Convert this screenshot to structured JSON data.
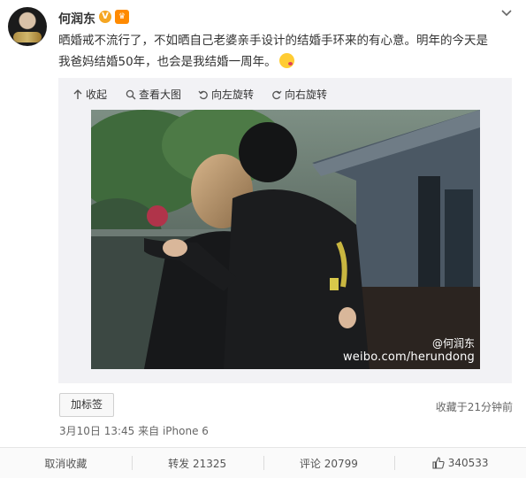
{
  "user": {
    "name": "何润东",
    "verified_badge": "V",
    "vip_badge": "♛"
  },
  "post": {
    "text_line1": "晒婚戒不流行了，不如晒自己老婆亲手设计的结婚手环来的有心意。明年的今天是",
    "text_line2": "我爸妈结婚50年，也会是我结婚一周年。",
    "emoji": "kiss-emoji"
  },
  "media_toolbar": {
    "collapse": "收起",
    "view_large": "查看大图",
    "rotate_left": "向左旋转",
    "rotate_right": "向右旋转"
  },
  "photo": {
    "watermark_handle": "@何润东",
    "watermark_url": "weibo.com/herundong"
  },
  "footer": {
    "tag_button": "加标签",
    "fav_time": "收藏于21分钟前",
    "date": "3月10日 13:45",
    "source": "来自 iPhone 6"
  },
  "actions": {
    "cancel_fav": "取消收藏",
    "repost": "转发 21325",
    "comment": "评论 20799",
    "like": "340533"
  },
  "colors": {
    "brand_badge": "#f5a623",
    "vip": "#ff8a00",
    "toolbar_bg": "#f2f2f5"
  }
}
